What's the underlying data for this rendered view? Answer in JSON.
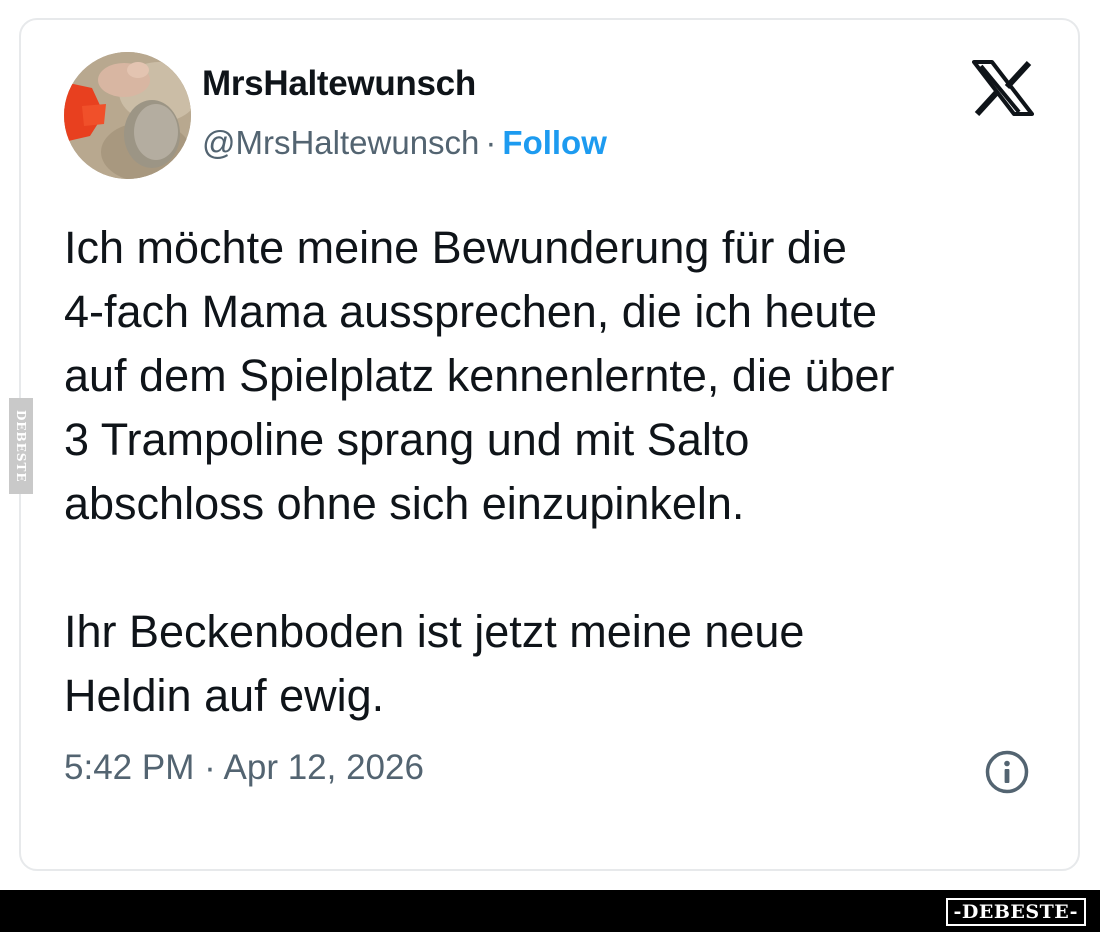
{
  "tweet": {
    "display_name": "MrsHaltewunsch",
    "handle": "@MrsHaltewunsch",
    "separator": "·",
    "follow_label": "Follow",
    "body": "Ich möchte meine Bewunderung für die\n4-fach Mama aussprechen, die ich heute\nauf dem Spielplatz kennenlernte, die über\n3 Trampoline sprang und mit Salto\nabschloss ohne sich einzupinkeln.\n\nIhr Beckenboden ist jetzt meine neue\nHeldin auf ewig.",
    "timestamp": "5:42 PM · Apr 12, 2026"
  },
  "icons": {
    "brand": "x-logo-icon",
    "info": "info-icon"
  },
  "watermark": {
    "side_text": "DEBESTE",
    "badge_text": "-DEBESTE-"
  },
  "colors": {
    "follow": "#1d9bf0",
    "text": "#0f1419",
    "secondary": "#536471",
    "card_border": "#e7e9eb",
    "bottom_bar": "#000000"
  }
}
